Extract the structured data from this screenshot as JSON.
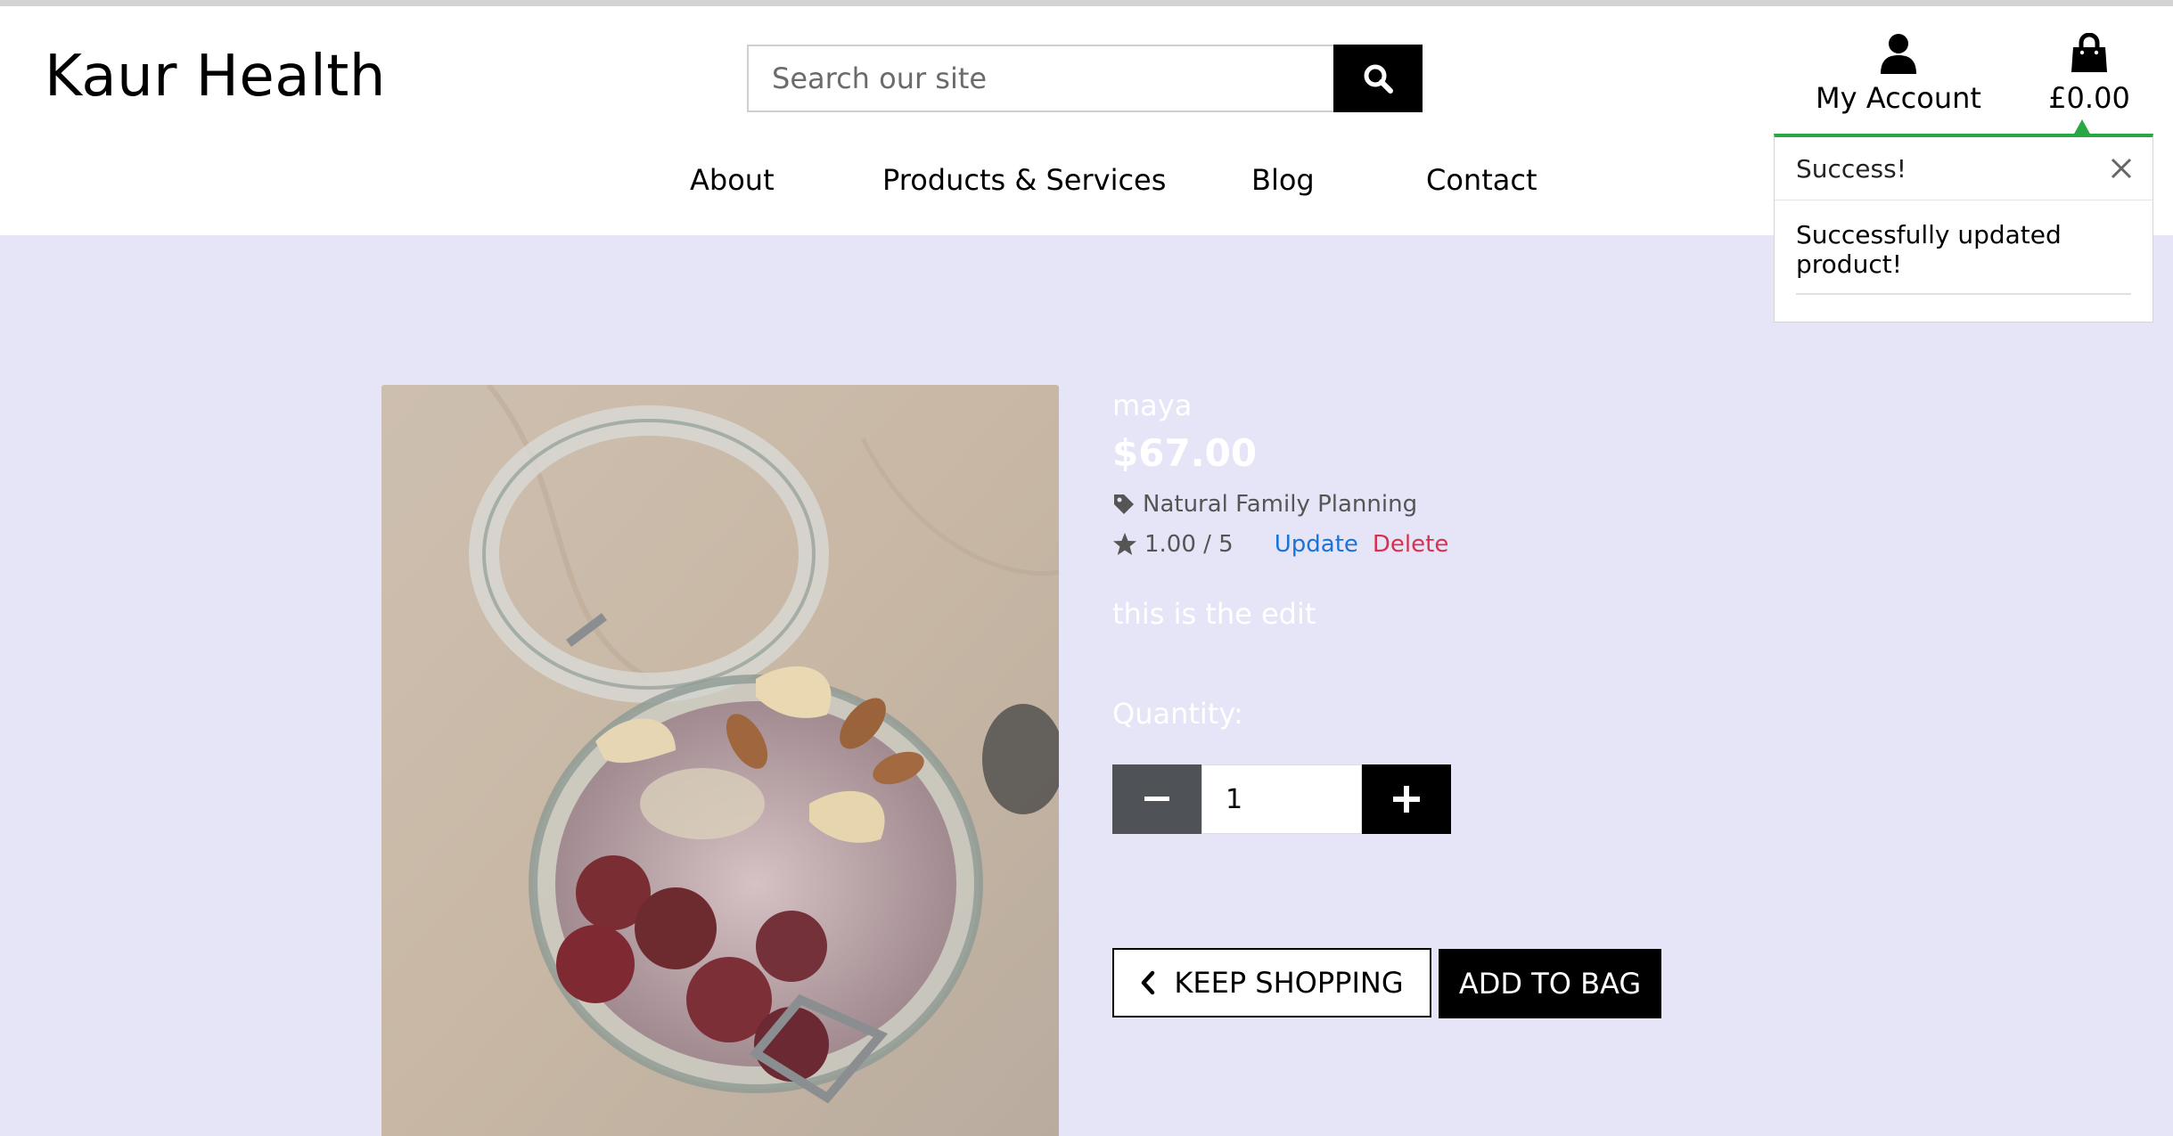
{
  "brand": {
    "title": "Kaur Health"
  },
  "search": {
    "placeholder": "Search our site"
  },
  "header": {
    "account_label": "My Account",
    "bag_total": "£0.00"
  },
  "nav": {
    "items": [
      "About",
      "Products & Services",
      "Blog",
      "Contact"
    ]
  },
  "toast": {
    "title": "Success!",
    "message": "Successfully updated product!"
  },
  "product": {
    "name": "maya",
    "price": "$67.00",
    "category": "Natural Family Planning",
    "rating": "1.00 / 5",
    "update_label": "Update",
    "delete_label": "Delete",
    "description": "this is the edit",
    "quantity_label": "Quantity:",
    "quantity_value": "1",
    "keep_shopping_label": "KEEP SHOPPING",
    "add_to_bag_label": "ADD TO BAG"
  },
  "colors": {
    "page_bg": "#e6e5f7",
    "success": "#28a745",
    "link": "#1a73d9",
    "danger": "#d9304f"
  }
}
